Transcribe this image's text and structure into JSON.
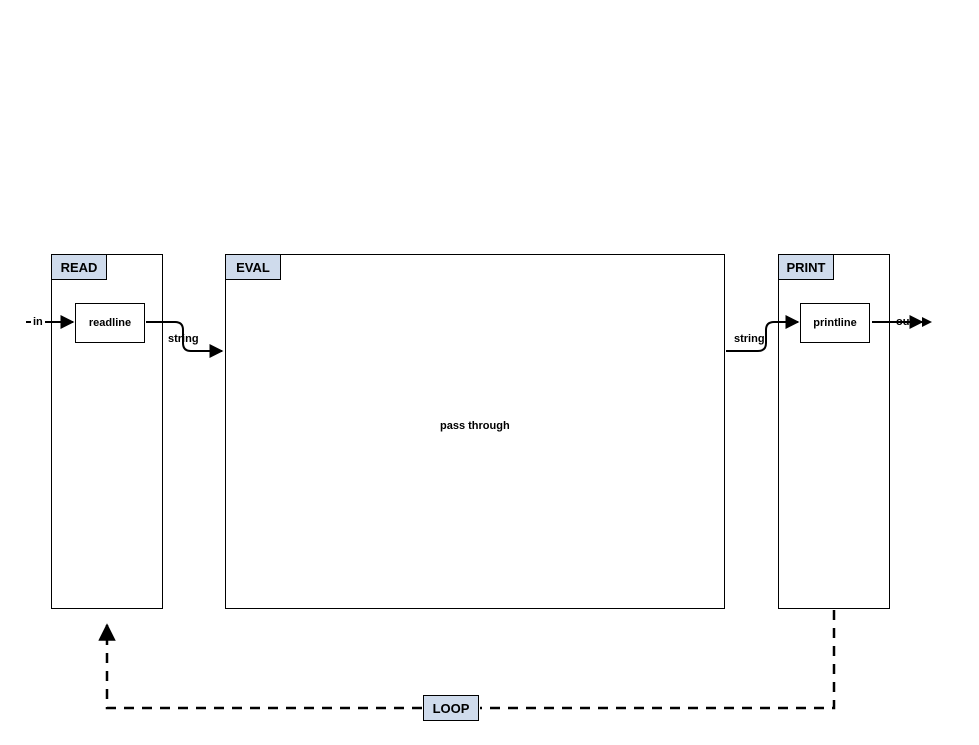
{
  "stages": {
    "read": {
      "label": "READ"
    },
    "eval": {
      "label": "EVAL"
    },
    "print": {
      "label": "PRINT"
    },
    "loop": {
      "label": "LOOP"
    }
  },
  "nodes": {
    "readline": "readline",
    "printline": "printline",
    "passthrough": "pass through"
  },
  "ports": {
    "in": "in",
    "out": "out",
    "string1": "string",
    "string2": "string"
  }
}
